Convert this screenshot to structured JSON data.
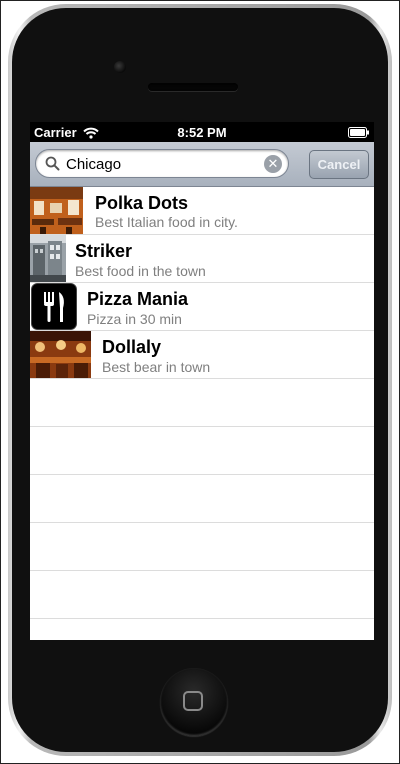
{
  "status_bar": {
    "carrier": "Carrier",
    "time": "8:52 PM"
  },
  "search": {
    "value": "Chicago",
    "cancel_label": "Cancel",
    "clear_glyph": "✕"
  },
  "results": [
    {
      "title": "Polka Dots",
      "subtitle": "Best Italian food in city.",
      "thumb": "restaurant-interior-photo"
    },
    {
      "title": "Striker",
      "subtitle": "Best food in the town",
      "thumb": "street-building-photo"
    },
    {
      "title": "Pizza Mania",
      "subtitle": "Pizza in 30 min",
      "thumb": "fork-knife-icon"
    },
    {
      "title": "Dollaly",
      "subtitle": "Best bear in town",
      "thumb": "bar-interior-photo"
    }
  ],
  "colors": {
    "status_bg": "#000000",
    "search_bar_bg": "#b4bcc7",
    "subtitle_text": "#7f7f7f",
    "separator": "#dcdcdc",
    "phone_body": "#101010"
  }
}
